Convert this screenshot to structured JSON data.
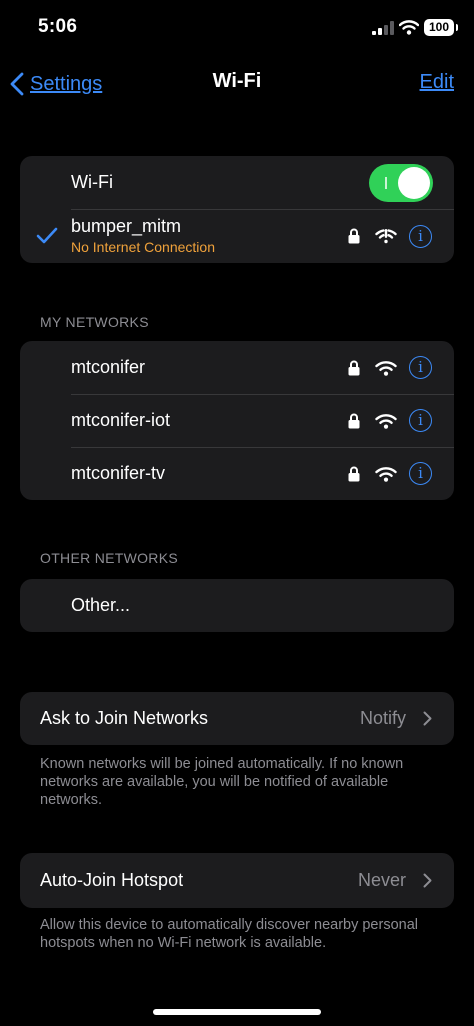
{
  "status_bar": {
    "time": "5:06",
    "battery": "100"
  },
  "nav": {
    "back_label": "Settings",
    "title": "Wi-Fi",
    "edit_label": "Edit"
  },
  "wifi": {
    "label": "Wi-Fi",
    "enabled": true,
    "current_network": {
      "name": "bumper_mitm",
      "status": "No Internet Connection",
      "status_color": "#f0a23b"
    }
  },
  "my_networks": {
    "header": "MY NETWORKS",
    "items": [
      {
        "name": "mtconifer"
      },
      {
        "name": "mtconifer-iot"
      },
      {
        "name": "mtconifer-tv"
      }
    ]
  },
  "other_networks": {
    "header": "OTHER NETWORKS",
    "other_label": "Other..."
  },
  "ask_to_join": {
    "label": "Ask to Join Networks",
    "value": "Notify",
    "footer": "Known networks will be joined automatically. If no known networks are available, you will be notified of available networks."
  },
  "auto_join_hotspot": {
    "label": "Auto-Join Hotspot",
    "value": "Never",
    "footer": "Allow this device to automatically discover nearby personal hotspots when no Wi-Fi network is available."
  },
  "colors": {
    "accent": "#3c8af7",
    "toggle_on": "#30d158",
    "cell_bg": "#1c1c1e",
    "secondary_text": "#8d8d93"
  },
  "icons": [
    "chevron-left-icon",
    "checkmark-icon",
    "lock-icon",
    "wifi-icon",
    "wifi-exclamation-icon",
    "info-icon",
    "chevron-right-icon"
  ]
}
